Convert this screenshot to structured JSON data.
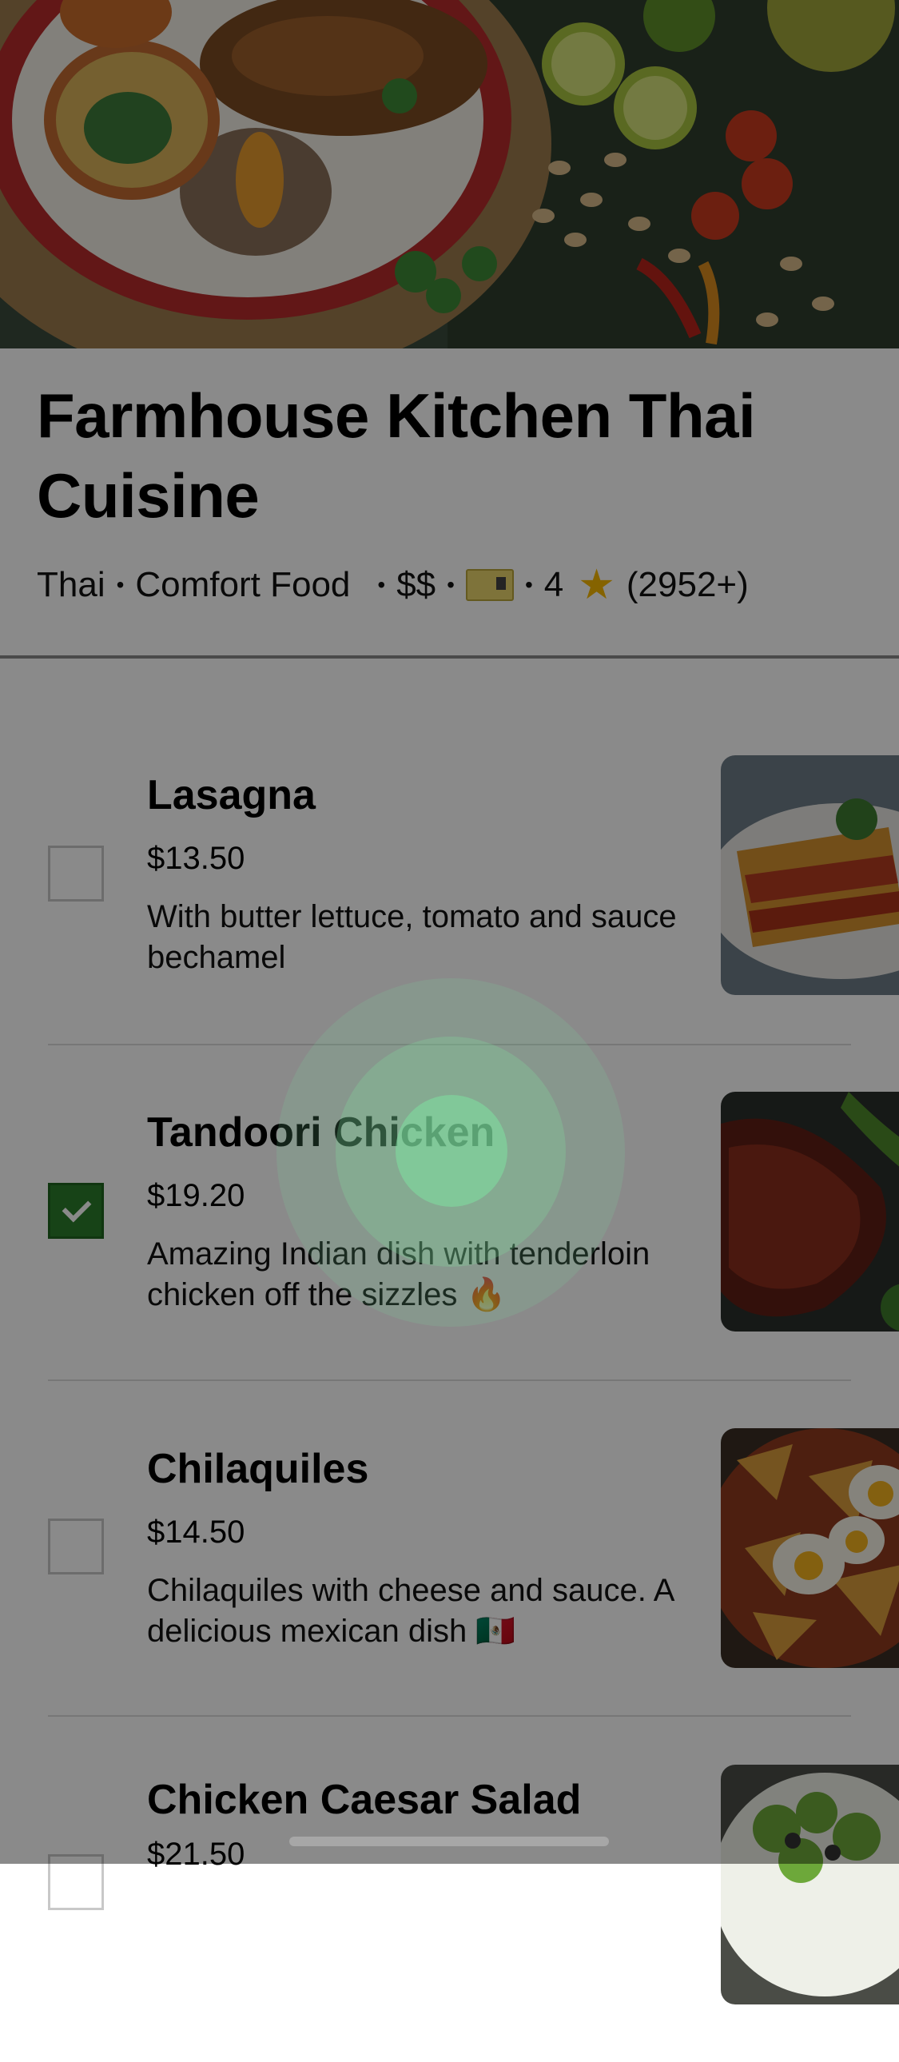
{
  "restaurant": {
    "name": "Farmhouse Kitchen Thai Cuisine",
    "cuisine_1": "Thai",
    "cuisine_2": "Comfort Food",
    "price_level": "$$",
    "ticket_icon": "ticket-icon",
    "rating": "4",
    "rating_icon": "star-icon",
    "review_count": "(2952+)"
  },
  "separator": "•",
  "menu": {
    "items": [
      {
        "name": "Lasagna",
        "price": "$13.50",
        "description": "With butter lettuce, tomato and sauce bechamel",
        "checked": false
      },
      {
        "name": "Tandoori Chicken",
        "price": "$19.20",
        "description": "Amazing Indian dish with tenderloin chicken off the sizzles 🔥",
        "checked": true
      },
      {
        "name": "Chilaquiles",
        "price": "$14.50",
        "description": "Chilaquiles with cheese and sauce. A delicious mexican dish 🇲🇽",
        "checked": false
      },
      {
        "name": "Chicken Caesar Salad",
        "price": "$21.50",
        "description": "",
        "checked": false
      }
    ]
  },
  "colors": {
    "checked": "#2b7d2b",
    "overlay": "rgba(0,0,0,0.46)",
    "tap_indicator": "#7ee0a0"
  }
}
